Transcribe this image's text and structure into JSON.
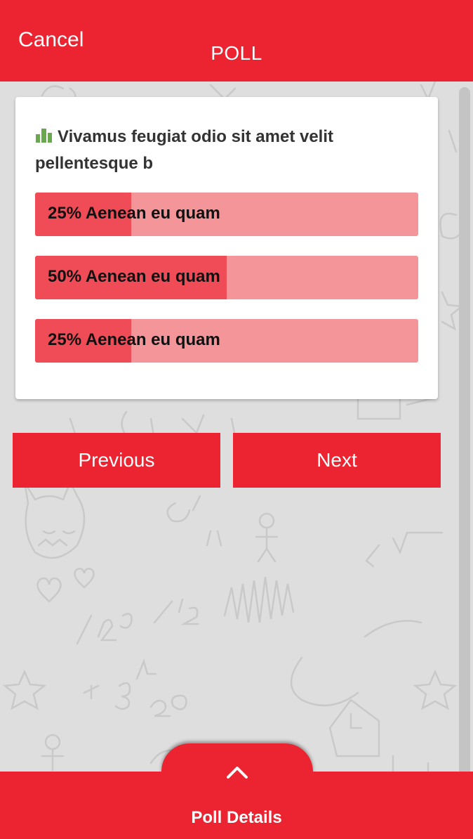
{
  "header": {
    "cancel_label": "Cancel",
    "title": "POLL"
  },
  "poll": {
    "question": "Vivamus feugiat odio sit amet velit pellentesque b",
    "question_icon": "bar-chart-icon",
    "options": [
      {
        "label": "25% Aenean eu quam",
        "percent": 25
      },
      {
        "label": "50% Aenean eu quam",
        "percent": 50
      },
      {
        "label": "25% Aenean eu quam",
        "percent": 25
      }
    ]
  },
  "navigation": {
    "previous_label": "Previous",
    "next_label": "Next"
  },
  "footer": {
    "details_label": "Poll Details",
    "toggle_icon": "chevron-up-icon"
  },
  "colors": {
    "brand_red": "#ec2330",
    "bar_fill": "#ef4c58",
    "bar_track": "#f4959a",
    "icon_green": "#6aa84f"
  }
}
